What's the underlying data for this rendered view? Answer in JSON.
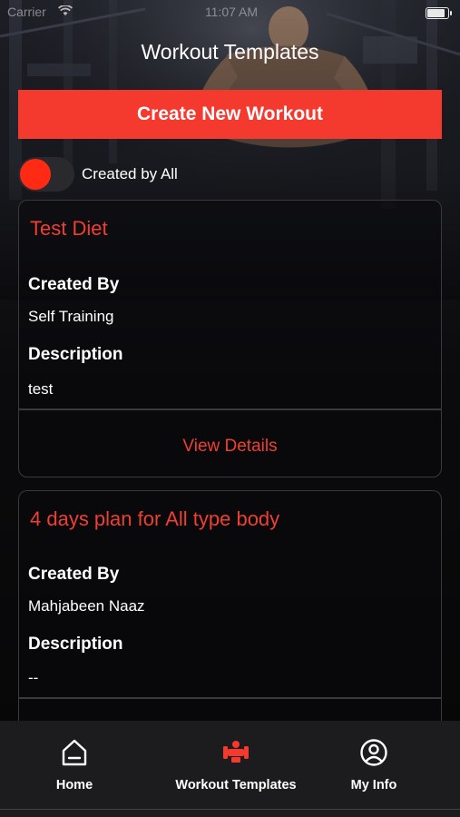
{
  "status_bar": {
    "carrier": "Carrier",
    "time": "11:07 AM"
  },
  "header": {
    "title": "Workout Templates"
  },
  "create_button": {
    "label": "Create New Workout"
  },
  "filter_toggle": {
    "label": "Created by All",
    "on": true
  },
  "templates": [
    {
      "title": "Test Diet",
      "created_by_label": "Created By",
      "created_by": "Self Training",
      "description_label": "Description",
      "description": "test",
      "action_label": "View Details"
    },
    {
      "title": "4 days plan for All type body",
      "created_by_label": "Created By",
      "created_by": "Mahjabeen Naaz",
      "description_label": "Description",
      "description": "--"
    }
  ],
  "tab_bar": {
    "items": [
      {
        "label": "Home",
        "icon": "home-icon"
      },
      {
        "label": "Workout Templates",
        "icon": "dumbbell-icon"
      },
      {
        "label": "My Info",
        "icon": "user-circle-icon"
      }
    ]
  },
  "colors": {
    "accent": "#f4392f",
    "accent_text": "#ef3f33",
    "tab_bar_bg": "#1c1c1e"
  }
}
